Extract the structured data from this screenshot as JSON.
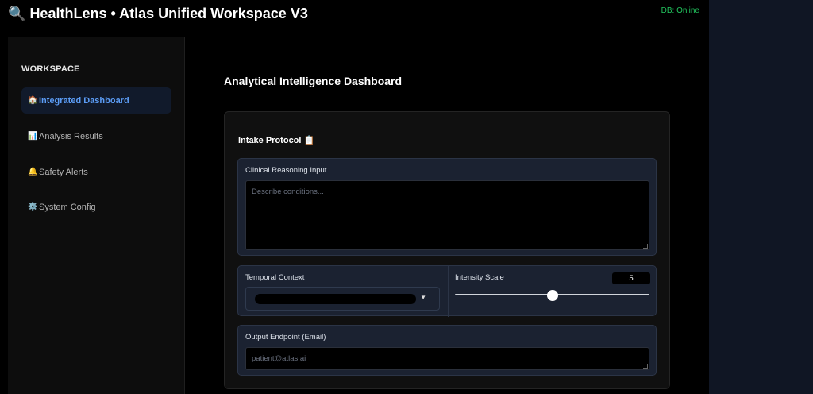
{
  "header": {
    "logo_icon": "🔍",
    "title": "HealthLens • Atlas Unified Workspace V3",
    "db_status": "DB: Online",
    "db_status_color": "#22c55e"
  },
  "sidebar": {
    "heading": "WORKSPACE",
    "items": [
      {
        "icon": "🏠",
        "icon_name": "home-icon",
        "label": "Integrated Dashboard",
        "active": true
      },
      {
        "icon": "📊",
        "icon_name": "bar-chart-icon",
        "label": "Analysis Results",
        "active": false
      },
      {
        "icon": "🔔",
        "icon_name": "bell-icon",
        "label": "Safety Alerts",
        "active": false
      },
      {
        "icon": "⚙️",
        "icon_name": "gear-icon",
        "label": "System Config",
        "active": false
      }
    ],
    "accent_color": "#5b9cf5"
  },
  "main": {
    "title": "Analytical Intelligence Dashboard",
    "card": {
      "title": "Intake Protocol",
      "title_icon": "📋",
      "clinical": {
        "label": "Clinical Reasoning Input",
        "value": "",
        "placeholder": "Describe conditions..."
      },
      "temporal": {
        "label": "Temporal Context",
        "value": ""
      },
      "intensity": {
        "label": "Intensity Scale",
        "value": "5",
        "fraction": 0.5
      },
      "email": {
        "label": "Output Endpoint (Email)",
        "value": "",
        "placeholder": "patient@atlas.ai"
      }
    }
  }
}
